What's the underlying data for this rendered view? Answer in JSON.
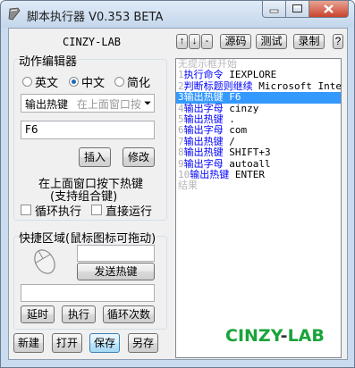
{
  "window": {
    "title": "脚本执行器 V0.353 BETA"
  },
  "left": {
    "header": "CINZY-LAB",
    "editor": {
      "group_title": "动作编辑器",
      "radios": [
        {
          "label": "英文",
          "selected": false
        },
        {
          "label": "中文",
          "selected": true
        },
        {
          "label": "简化",
          "selected": false
        }
      ],
      "action_select": {
        "value": "输出热键",
        "hint": "在上面窗口按"
      },
      "param_value": "F6",
      "insert_label": "插入",
      "modify_label": "修改",
      "instruction_line1": "在上面窗口按下热键",
      "instruction_line2": "(支持组合键)",
      "loop_label": "循环执行",
      "direct_run_label": "直接运行"
    },
    "quick": {
      "group_title": "快捷区域(鼠标图标可拖动)",
      "send_hotkey_label": "发送热键",
      "delay_label": "延时",
      "execute_label": "执行",
      "loop_count_label": "循环次数"
    },
    "bottom": {
      "new_label": "新建",
      "open_label": "打开",
      "save_label": "保存",
      "save_as_label": "另存"
    }
  },
  "right": {
    "toolbar": {
      "up": "↑",
      "down": "↓",
      "minus": "-",
      "source_label": "源码",
      "test_label": "测试",
      "record_label": "录制",
      "help_label": "?"
    },
    "script_lines": [
      {
        "num": "",
        "cmd": "无提示框开始",
        "arg": "",
        "hint": true,
        "selected": false
      },
      {
        "num": "1",
        "cmd": "执行命令",
        "arg": "IEXPLORE",
        "hint": false,
        "selected": false
      },
      {
        "num": "2",
        "cmd": "判断标题则继续",
        "arg": "Microsoft Inter",
        "hint": false,
        "selected": false
      },
      {
        "num": "3",
        "cmd": "输出热键",
        "arg": "F6",
        "hint": false,
        "selected": true
      },
      {
        "num": "4",
        "cmd": "输出字母",
        "arg": "cinzy",
        "hint": false,
        "selected": false
      },
      {
        "num": "5",
        "cmd": "输出热键",
        "arg": ".",
        "hint": false,
        "selected": false
      },
      {
        "num": "6",
        "cmd": "输出字母",
        "arg": "com",
        "hint": false,
        "selected": false
      },
      {
        "num": "7",
        "cmd": "输出热键",
        "arg": "/",
        "hint": false,
        "selected": false
      },
      {
        "num": "8",
        "cmd": "输出热键",
        "arg": "SHIFT+3",
        "hint": false,
        "selected": false
      },
      {
        "num": "9",
        "cmd": "输出字母",
        "arg": "autoall",
        "hint": false,
        "selected": false
      },
      {
        "num": "10",
        "cmd": "输出热键",
        "arg": "ENTER",
        "hint": false,
        "selected": false
      },
      {
        "num": "",
        "cmd": "结果",
        "arg": "",
        "hint": true,
        "selected": false
      }
    ],
    "brand": {
      "part1": "CINZY",
      "dash": "-",
      "part2": "LAB"
    }
  },
  "colors": {
    "brand_green": "#1aa43a",
    "brand_dash": "#333333",
    "selection": "#3399ff",
    "command_blue": "#0000ff",
    "title_bar": "#c9dcef"
  },
  "icons": [
    "app-icon",
    "minimize-icon",
    "maximize-icon",
    "close-icon",
    "mouse-icon",
    "dropdown-arrow-icon"
  ]
}
